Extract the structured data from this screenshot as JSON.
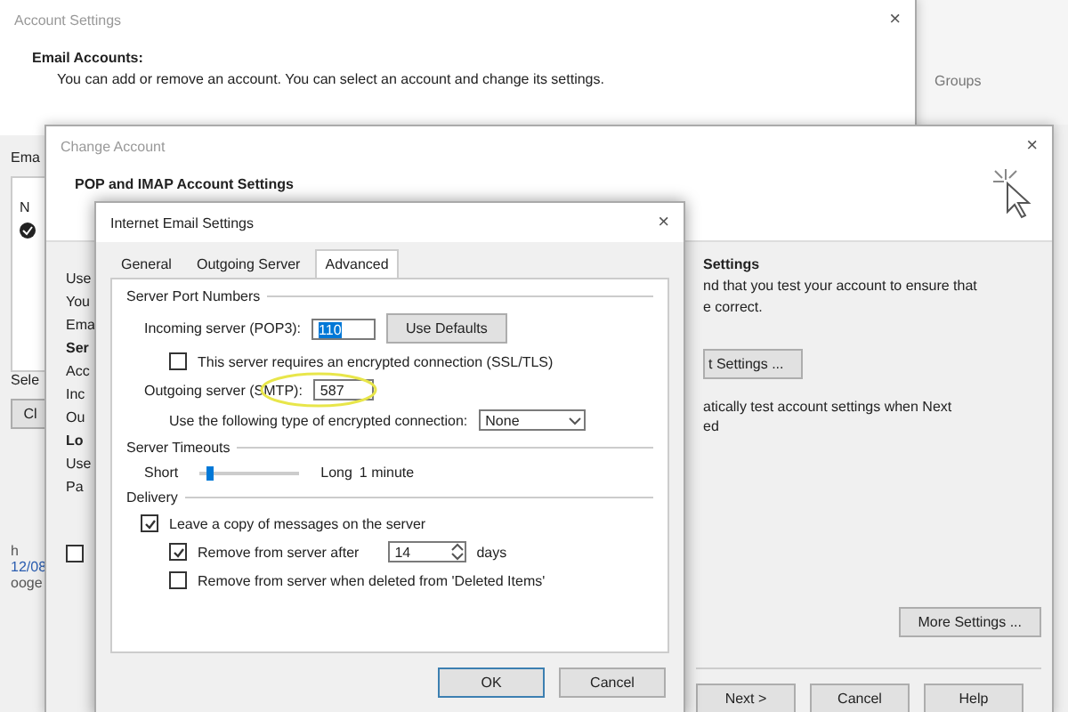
{
  "account_settings": {
    "title": "Account Settings",
    "close": "×",
    "heading": "Email Accounts:",
    "description": "You can add or remove an account. You can select an account and change its settings.",
    "tab_fragment": "Ema",
    "list_fragment": "N",
    "select_fragment": "Sele",
    "button_fragment": "Cl",
    "footer_fragments": [
      "h",
      "12/08",
      "ooge"
    ]
  },
  "side_window": {
    "column": "Groups"
  },
  "change_account": {
    "title": "Change Account",
    "close": "×",
    "heading": "POP and IMAP Account Settings",
    "left_fragments": [
      {
        "text": "Use",
        "bold": false
      },
      {
        "text": "You",
        "bold": false
      },
      {
        "text": "Ema",
        "bold": false
      },
      {
        "text": "Ser",
        "bold": true
      },
      {
        "text": "Acc",
        "bold": false
      },
      {
        "text": "Inc",
        "bold": false
      },
      {
        "text": "Ou",
        "bold": false
      },
      {
        "text": "Lo",
        "bold": true
      },
      {
        "text": "Use",
        "bold": false
      },
      {
        "text": "Pa",
        "bold": false
      }
    ],
    "checkbox": {
      "checked": false
    },
    "right_heading": "Settings",
    "right_lines": [
      "nd that you test your account to ensure that",
      "e correct."
    ],
    "test_button": "t Settings ...",
    "auto_lines": [
      "atically test account settings when Next",
      "ed"
    ],
    "more_settings": "More Settings ...",
    "buttons": [
      "Next >",
      "Cancel",
      "Help"
    ]
  },
  "email_settings": {
    "title": "Internet Email Settings",
    "close": "×",
    "tabs": [
      {
        "label": "General",
        "selected": false
      },
      {
        "label": "Outgoing Server",
        "selected": false
      },
      {
        "label": "Advanced",
        "selected": true
      }
    ],
    "port_group": "Server Port Numbers",
    "incoming_label": "Incoming server (POP3):",
    "incoming_value": "110",
    "use_defaults": "Use Defaults",
    "ssl": {
      "label": "This server requires an encrypted connection (SSL/TLS)",
      "checked": false
    },
    "outgoing_label": "Outgoing server (SMTP):",
    "outgoing_value": "587",
    "encryption_label": "Use the following type of encrypted connection:",
    "encryption_value": "None",
    "timeout_group": "Server Timeouts",
    "short": "Short",
    "long": "Long",
    "timeout_value": "1 minute",
    "timeout": {
      "level": 0.1
    },
    "delivery_group": "Delivery",
    "leave_copy": {
      "label": "Leave a copy of messages on the server",
      "checked": true
    },
    "remove_after": {
      "label": "Remove from server after",
      "checked": true
    },
    "days_value": "14",
    "days": "days",
    "remove_deleted": {
      "label": "Remove from server when deleted from 'Deleted Items'",
      "checked": false
    },
    "ok": "OK",
    "cancel": "Cancel"
  }
}
